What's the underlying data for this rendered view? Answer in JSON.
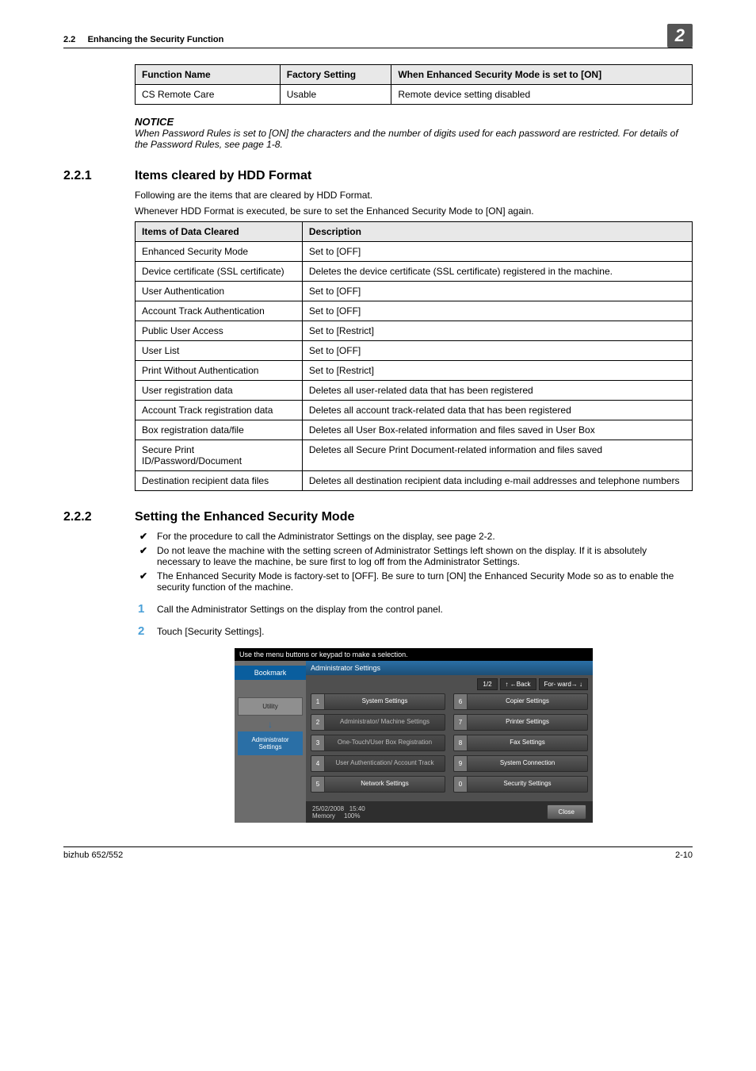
{
  "header": {
    "section_num": "2.2",
    "section_title": "Enhancing the Security Function",
    "chapter_badge": "2"
  },
  "table_a": {
    "headers": [
      "Function Name",
      "Factory Setting",
      "When Enhanced Security Mode is set to [ON]"
    ],
    "rows": [
      [
        "CS Remote Care",
        "Usable",
        "Remote device setting disabled"
      ]
    ]
  },
  "notice": {
    "title": "NOTICE",
    "body": "When Password Rules is set to [ON] the characters and the number of digits used for each password are restricted. For details of the Password Rules, see page 1-8."
  },
  "sec221": {
    "num": "2.2.1",
    "title": "Items cleared by HDD Format",
    "p1": "Following are the items that are cleared by HDD Format.",
    "p2": "Whenever HDD Format is executed, be sure to set the Enhanced Security Mode to [ON] again."
  },
  "table_b": {
    "headers": [
      "Items of Data Cleared",
      "Description"
    ],
    "rows": [
      [
        "Enhanced Security Mode",
        "Set to [OFF]"
      ],
      [
        "Device certificate (SSL certificate)",
        "Deletes the device certificate (SSL certificate) registered in the machine."
      ],
      [
        "User Authentication",
        "Set to [OFF]"
      ],
      [
        "Account Track Authentication",
        "Set to [OFF]"
      ],
      [
        "Public User Access",
        "Set to [Restrict]"
      ],
      [
        "User List",
        "Set to [OFF]"
      ],
      [
        "Print Without Authentication",
        "Set to [Restrict]"
      ],
      [
        "User registration data",
        "Deletes all user-related data that has been registered"
      ],
      [
        "Account Track registration data",
        "Deletes all account track-related data that has been registered"
      ],
      [
        "Box registration data/file",
        "Deletes all User Box-related information and files saved in User Box"
      ],
      [
        "Secure Print ID/Password/Document",
        "Deletes all Secure Print Document-related information and files saved"
      ],
      [
        "Destination recipient data files",
        "Deletes all destination recipient data including e-mail addresses and telephone numbers"
      ]
    ]
  },
  "sec222": {
    "num": "2.2.2",
    "title": "Setting the Enhanced Security Mode",
    "checks": [
      "For the procedure to call the Administrator Settings on the display, see page 2-2.",
      "Do not leave the machine with the setting screen of Administrator Settings left shown on the display. If it is absolutely necessary to leave the machine, be sure first to log off from the Administrator Settings.",
      "The Enhanced Security Mode is factory-set to [OFF]. Be sure to turn [ON] the Enhanced Security Mode so as to enable the security function of the machine."
    ],
    "steps": [
      "Call the Administrator Settings on the display from the control panel.",
      "Touch [Security Settings]."
    ]
  },
  "panel": {
    "top": "Use the menu buttons or keypad to make a selection.",
    "bookmark": "Bookmark",
    "utility": "Utility",
    "admin": "Administrator Settings",
    "title": "Administrator Settings",
    "page": "1/2",
    "back": "↑ ←Back",
    "fwd": "For- ward→ ↓",
    "menu": [
      {
        "n": "1",
        "l": "System Settings"
      },
      {
        "n": "6",
        "l": "Copier Settings"
      },
      {
        "n": "2",
        "l": "Administrator/ Machine Settings"
      },
      {
        "n": "7",
        "l": "Printer Settings"
      },
      {
        "n": "3",
        "l": "One-Touch/User Box Registration"
      },
      {
        "n": "8",
        "l": "Fax Settings"
      },
      {
        "n": "4",
        "l": "User Authentication/ Account Track"
      },
      {
        "n": "9",
        "l": "System Connection"
      },
      {
        "n": "5",
        "l": "Network Settings"
      },
      {
        "n": "0",
        "l": "Security Settings"
      }
    ],
    "date": "25/02/2008",
    "time": "15:40",
    "mem_label": "Memory",
    "mem_value": "100%",
    "close": "Close"
  },
  "footer": {
    "left": "bizhub 652/552",
    "right": "2-10"
  }
}
